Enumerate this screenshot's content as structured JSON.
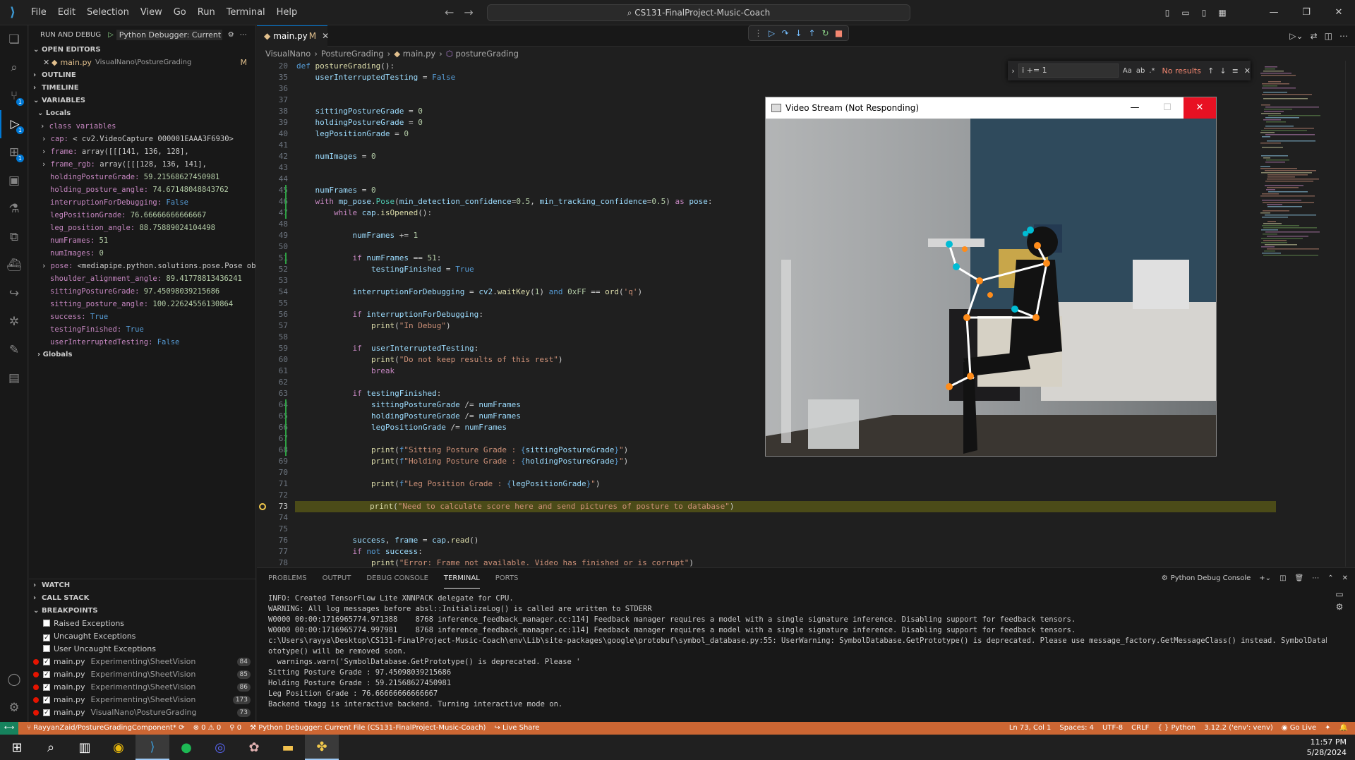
{
  "titlebar": {
    "menu": [
      "File",
      "Edit",
      "Selection",
      "View",
      "Go",
      "Run",
      "Terminal",
      "Help"
    ],
    "search": "CS131-FinalProject-Music-Coach"
  },
  "sidebar": {
    "header": "RUN AND DEBUG",
    "config": "Python Debugger: Current F",
    "open_editors_label": "OPEN EDITORS",
    "open_file": "main.py",
    "open_file_path": "VisualNano\\PostureGrading",
    "open_file_status": "M",
    "outline_label": "OUTLINE",
    "timeline_label": "TIMELINE",
    "variables_label": "VARIABLES",
    "locals_label": "Locals",
    "globals_label": "Globals",
    "variables": [
      {
        "name": "class variables",
        "value": ""
      },
      {
        "name": "cap:",
        "value": "< cv2.VideoCapture 000001EAAA3F6930>"
      },
      {
        "name": "frame:",
        "value": "array([[[141, 136, 128],"
      },
      {
        "name": "frame_rgb:",
        "value": "array([[[128, 136, 141],"
      },
      {
        "name": "holdingPostureGrade:",
        "value": "59.21568627450981"
      },
      {
        "name": "holding_posture_angle:",
        "value": "74.67148048843762"
      },
      {
        "name": "interruptionForDebugging:",
        "value": "False"
      },
      {
        "name": "legPositionGrade:",
        "value": "76.66666666666667"
      },
      {
        "name": "leg_position_angle:",
        "value": "88.75889024104498"
      },
      {
        "name": "numFrames:",
        "value": "51"
      },
      {
        "name": "numImages:",
        "value": "0"
      },
      {
        "name": "pose:",
        "value": "<mediapipe.python.solutions.pose.Pose obje…"
      },
      {
        "name": "shoulder_alignment_angle:",
        "value": "89.41778813436241"
      },
      {
        "name": "sittingPostureGrade:",
        "value": "97.45098039215686"
      },
      {
        "name": "sitting_posture_angle:",
        "value": "100.22624556130864"
      },
      {
        "name": "success:",
        "value": "True"
      },
      {
        "name": "testingFinished:",
        "value": "True"
      },
      {
        "name": "userInterruptedTesting:",
        "value": "False"
      }
    ],
    "watch_label": "WATCH",
    "callstack_label": "CALL STACK",
    "breakpoints_label": "BREAKPOINTS",
    "exceptions": [
      {
        "label": "Raised Exceptions",
        "checked": false
      },
      {
        "label": "Uncaught Exceptions",
        "checked": true
      },
      {
        "label": "User Uncaught Exceptions",
        "checked": false
      }
    ],
    "breakpoints": [
      {
        "file": "main.py",
        "path": "Experimenting\\SheetVision",
        "line": "84"
      },
      {
        "file": "main.py",
        "path": "Experimenting\\SheetVision",
        "line": "85"
      },
      {
        "file": "main.py",
        "path": "Experimenting\\SheetVision",
        "line": "86"
      },
      {
        "file": "main.py",
        "path": "Experimenting\\SheetVision",
        "line": "173"
      },
      {
        "file": "main.py",
        "path": "VisualNano\\PostureGrading",
        "line": "73"
      }
    ]
  },
  "editor": {
    "tab_label": "main.py",
    "tab_status": "M",
    "breadcrumb": [
      "VisualNano",
      "PostureGrading",
      "main.py",
      "postureGrading"
    ],
    "find": {
      "query": "i += 1",
      "result": "No results"
    },
    "line_numbers": [
      "20",
      "35",
      "36",
      "37",
      "38",
      "39",
      "40",
      "41",
      "42",
      "43",
      "44",
      "45",
      "46",
      "47",
      "48",
      "49",
      "50",
      "51",
      "52",
      "53",
      "54",
      "55",
      "56",
      "57",
      "58",
      "59",
      "60",
      "61",
      "62",
      "63",
      "64",
      "65",
      "66",
      "67",
      "68",
      "69",
      "70",
      "71",
      "72",
      "73",
      "74",
      "75",
      "76",
      "77",
      "78"
    ]
  },
  "video_window": {
    "title": "Video Stream (Not Responding)"
  },
  "panel": {
    "tabs": [
      "PROBLEMS",
      "OUTPUT",
      "DEBUG CONSOLE",
      "TERMINAL",
      "PORTS"
    ],
    "active_tab": "TERMINAL",
    "terminal_name": "Python Debug Console",
    "terminal_lines": [
      "INFO: Created TensorFlow Lite XNNPACK delegate for CPU.",
      "WARNING: All log messages before absl::InitializeLog() is called are written to STDERR",
      "W0000 00:00:1716965774.971388    8768 inference_feedback_manager.cc:114] Feedback manager requires a model with a single signature inference. Disabling support for feedback tensors.",
      "W0000 00:00:1716965774.997981    8768 inference_feedback_manager.cc:114] Feedback manager requires a model with a single signature inference. Disabling support for feedback tensors.",
      "c:\\Users\\rayya\\Desktop\\CS131-FinalProject-Music-Coach\\env\\Lib\\site-packages\\google\\protobuf\\symbol_database.py:55: UserWarning: SymbolDatabase.GetPrototype() is deprecated. Please use message_factory.GetMessageClass() instead. SymbolDatabase.GetPr",
      "ototype() will be removed soon.",
      "  warnings.warn('SymbolDatabase.GetPrototype() is deprecated. Please '",
      "Sitting Posture Grade : 97.45098039215686",
      "Holding Posture Grade : 59.21568627450981",
      "Leg Position Grade : 76.66666666666667",
      "Backend tkagg is interactive backend. Turning interactive mode on."
    ]
  },
  "status": {
    "branch": "RayyanZaid/PostureGradingComponent*",
    "errors": "0",
    "warnings": "0",
    "ports": "0",
    "debug": "Python Debugger: Current File (CS131-FinalProject-Music-Coach)",
    "liveshare": "Live Share",
    "position": "Ln 73, Col 1",
    "spaces": "Spaces: 4",
    "encoding": "UTF-8",
    "eol": "CRLF",
    "language": "Python",
    "interpreter": "3.12.2 ('env': venv)",
    "golive": "Go Live"
  },
  "taskbar": {
    "time": "11:57 PM",
    "date": "5/28/2024"
  },
  "colors": {
    "statusbar": "#cc6633",
    "accent": "#0078d4",
    "debug_line": "#4b4b18"
  }
}
